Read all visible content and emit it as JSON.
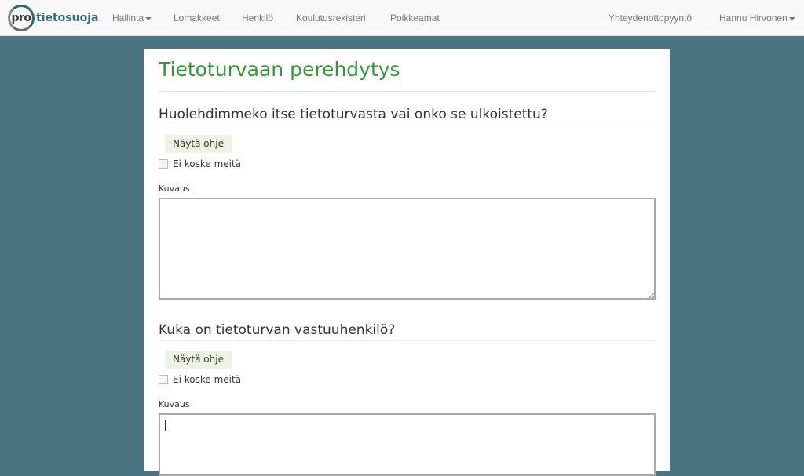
{
  "brand": {
    "mark": "pro",
    "name": "tietosuoja"
  },
  "nav": {
    "left": [
      {
        "label": "Hallinta",
        "dropdown": true
      },
      {
        "label": "Lomakkeet"
      },
      {
        "label": "Henkilö"
      },
      {
        "label": "Koulutusrekisteri"
      },
      {
        "label": "Poikkeamat"
      }
    ],
    "right": [
      {
        "label": "Yhteydenottopyyntö"
      },
      {
        "label": "Hannu Hirvonen",
        "dropdown": true
      }
    ]
  },
  "page": {
    "title": "Tietoturvaan perehdytys",
    "questions": [
      {
        "heading": "Huolehdimmeko itse tietoturvasta vai onko se ulkoistettu?",
        "help_label": "Näytä ohje",
        "checkbox_label": "Ei koske meitä",
        "checked": false,
        "field_label": "Kuvaus",
        "value": ""
      },
      {
        "heading": "Kuka on tietoturvan vastuuhenkilö?",
        "help_label": "Näytä ohje",
        "checkbox_label": "Ei koske meitä",
        "checked": false,
        "field_label": "Kuvaus",
        "value": ""
      }
    ]
  },
  "colors": {
    "background": "#4b7582",
    "title": "#2e9a33",
    "help_button": "#eef4e4",
    "brand": "#2f6b7a"
  }
}
